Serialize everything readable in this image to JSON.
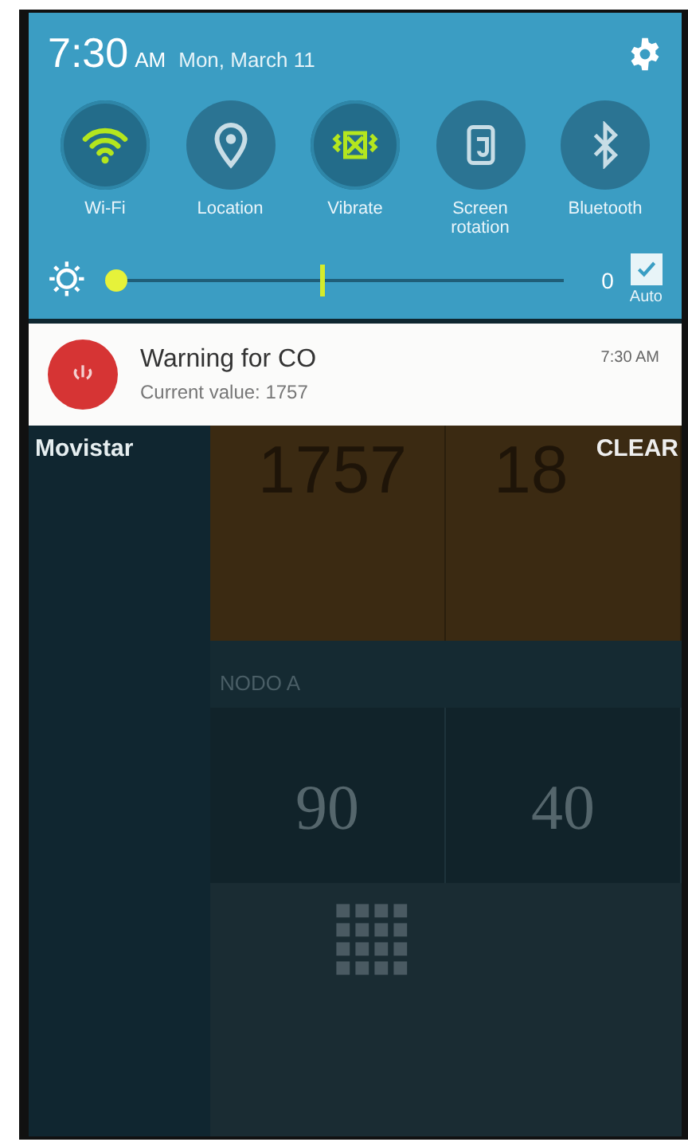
{
  "status": {
    "time": "7:30",
    "ampm": "AM",
    "date": "Mon, March 11"
  },
  "toggles": [
    {
      "label": "Wi-Fi",
      "kind": "wifi",
      "on": true
    },
    {
      "label": "Location",
      "kind": "location",
      "on": false
    },
    {
      "label": "Vibrate",
      "kind": "vibrate",
      "on": true
    },
    {
      "label": "Screen rotation",
      "kind": "rotation",
      "on": false
    },
    {
      "label": "Bluetooth",
      "kind": "bluetooth",
      "on": false
    }
  ],
  "brightness": {
    "level": 0.0,
    "reading": "0",
    "auto_label": "Auto",
    "auto_checked": true
  },
  "notification": {
    "title": "Warning for CO",
    "text": "Current value: 1757",
    "time": "7:30 AM"
  },
  "carrier": "Movistar",
  "clear_button": "CLEAR",
  "background_app": {
    "top_values": [
      "1757",
      "18"
    ],
    "section_title": "NODO A",
    "section_values": [
      "90",
      "40"
    ]
  }
}
